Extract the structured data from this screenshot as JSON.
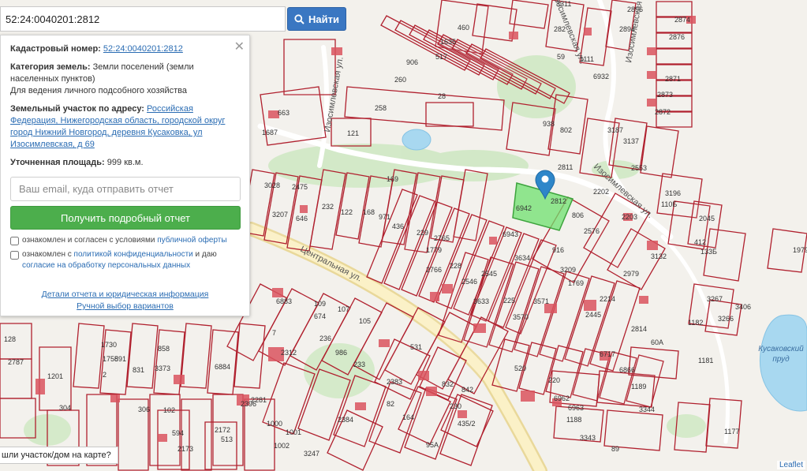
{
  "search": {
    "value": "52:24:0040201:2812",
    "button_label": "Найти"
  },
  "info": {
    "cadastral_label": "Кадастровый номер:",
    "cadastral_value": "52:24:0040201:2812",
    "category_label": "Категория земель:",
    "category_value": "Земли поселений (земли населенных пунктов)",
    "usage": "Для ведения личного подсобного хозяйства",
    "address_label": "Земельный участок по адресу:",
    "address_value": "Российская Федерация, Нижегородская область, городской округ город Нижний Новгород, деревня Кусаковка, ул Изосимлевская, д 69",
    "area_label": "Уточненная площадь:",
    "area_value": "999 кв.м.",
    "email_placeholder": "Ваш email, куда отправить отчет",
    "report_button": "Получить подробный отчет",
    "consent1_prefix": "ознакомлен и согласен с условиями ",
    "consent1_link": "публичной оферты",
    "consent2_prefix": "ознакомлен с ",
    "consent2_link1": "политикой конфиденциальности",
    "consent2_mid": " и даю",
    "consent2_link2": "согласие на обработку персональных данных",
    "details_link": "Детали отчета и юридическая информация",
    "manual_link": "Ручной выбор вариантов"
  },
  "own_plot_prompt": "шли участок/дом на карте?",
  "attribution": "Leaflet",
  "pond_label": "Кусаковский пруд",
  "streets": {
    "central": "Центральная ул.",
    "izosim_top": "Изосимлевская ул.",
    "izosim_left": "Изосимлевская ул.",
    "izosim_mid": "Изосимлевская ул.",
    "izosim_right": "Изосимлевская ул."
  },
  "colors": {
    "parcel_border": "#b0202e",
    "selected_parcel": "#6fe06f",
    "search_button": "#3a77c2",
    "report_button": "#4cae4c",
    "link": "#2a6cb3"
  },
  "selected_parcel_number": "2812",
  "parcel_numbers": [
    "2874",
    "2876",
    "2871",
    "2873",
    "2872",
    "3311",
    "2896",
    "2894",
    "460",
    "282",
    "59",
    "1111",
    "6932",
    "1635",
    "517",
    "906",
    "260",
    "28",
    "258",
    "663",
    "1687",
    "121",
    "938",
    "802",
    "3187",
    "3137",
    "2811",
    "2202",
    "2553",
    "3196",
    "110Б",
    "2045",
    "412",
    "133Б",
    "1979",
    "3028",
    "2475",
    "3207",
    "646",
    "232",
    "122",
    "168",
    "169",
    "971",
    "436",
    "229",
    "2765",
    "1779",
    "2766",
    "228",
    "6942",
    "6943",
    "3634",
    "916",
    "3209",
    "1769",
    "2576",
    "806",
    "2203",
    "3132",
    "2979",
    "2546",
    "2545",
    "3633",
    "225",
    "3570",
    "3571",
    "2214",
    "2445",
    "2814",
    "60А",
    "6883",
    "109",
    "107",
    "105",
    "7",
    "674",
    "2312",
    "236",
    "986",
    "233",
    "531",
    "6884",
    "2383",
    "82",
    "164",
    "1730",
    "1758",
    "591",
    "831",
    "2",
    "858",
    "3373",
    "1201",
    "2787",
    "306",
    "102",
    "594",
    "2172",
    "513",
    "2173",
    "2281",
    "2396",
    "1000",
    "1001",
    "1002",
    "3247",
    "2384",
    "832",
    "842",
    "230",
    "435/2",
    "95А",
    "520",
    "220",
    "6962",
    "6963",
    "1188",
    "3343",
    "89",
    "6717",
    "6866",
    "1189",
    "3344",
    "3267",
    "3406",
    "3266",
    "1182",
    "1181",
    "1177",
    "304",
    "128"
  ]
}
